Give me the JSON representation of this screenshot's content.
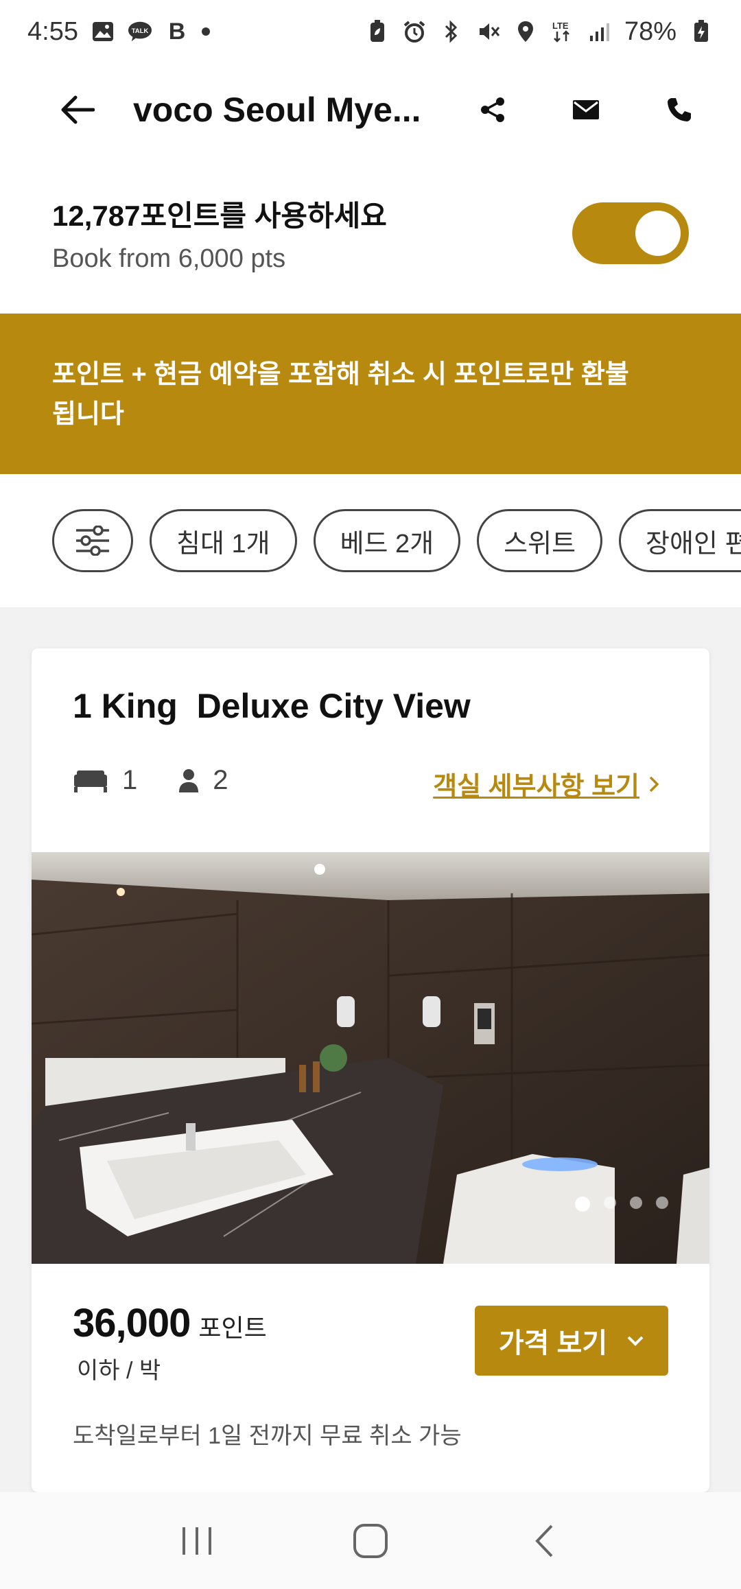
{
  "status_bar": {
    "time": "4:55",
    "battery": "78%",
    "left_icons": [
      "gallery-icon",
      "talk-icon",
      "b-app-icon",
      "dot-icon"
    ],
    "right_icons": [
      "battery-saver-icon",
      "alarm-icon",
      "bluetooth-icon",
      "mute-icon",
      "location-icon",
      "lte-icon",
      "signal-icon",
      "battery-icon"
    ],
    "talk_label": "TALK",
    "b_label": "B"
  },
  "header": {
    "title": "voco Seoul Mye...",
    "actions": [
      "share-icon",
      "mail-icon",
      "phone-icon"
    ]
  },
  "points": {
    "title": "12,787포인트를 사용하세요",
    "subtitle": "Book from 6,000 pts",
    "toggle_on": true
  },
  "banner": {
    "text": "포인트 + 현금 예약을 포함해 취소 시 포인트로만 환불됩니다"
  },
  "filters": {
    "chips": [
      "침대 1개",
      "베드 2개",
      "스위트",
      "장애인 편"
    ]
  },
  "room": {
    "title": "1 King  Deluxe City View",
    "beds": "1",
    "guests": "2",
    "details_link": "객실 세부사항 보기",
    "photo_count": 4,
    "active_photo": 1,
    "price": "36,000",
    "price_unit": "포인트",
    "price_per": "이하 / 박",
    "price_button": "가격 보기",
    "cancel_note": "도착일로부터 1일 전까지 무료 취소 가능"
  },
  "colors": {
    "accent": "#b8890f",
    "background": "#ffffff",
    "gray_area": "#f2f2f2"
  }
}
